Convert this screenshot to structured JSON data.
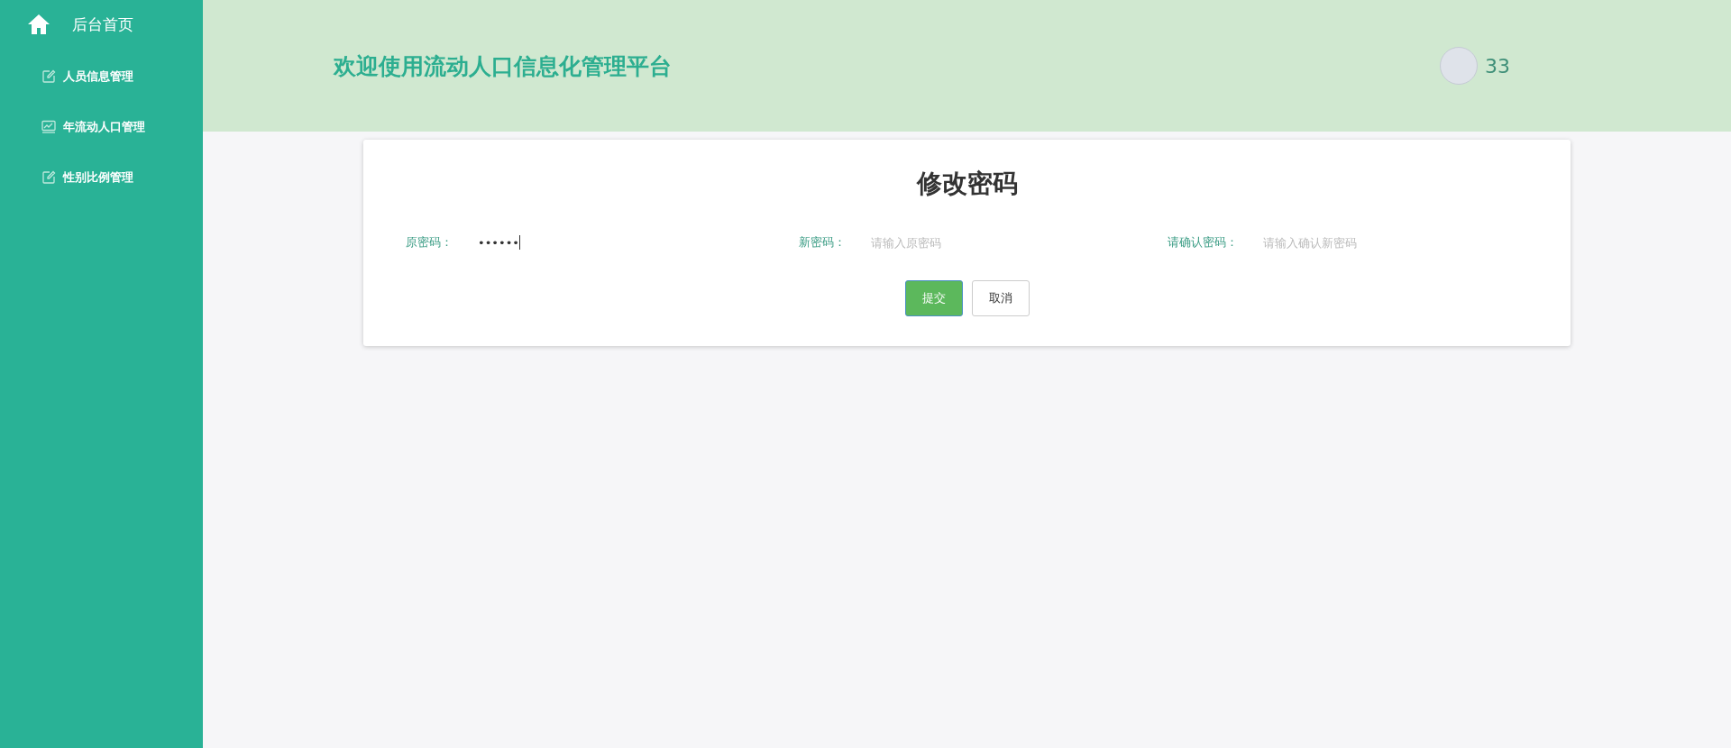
{
  "sidebar": {
    "home": {
      "label": "后台首页"
    },
    "items": [
      {
        "label": "人员信息管理",
        "kind": "edit"
      },
      {
        "label": "年流动人口管理",
        "kind": "chart"
      },
      {
        "label": "性别比例管理",
        "kind": "edit"
      }
    ]
  },
  "header": {
    "title": "欢迎使用流动人口信息化管理平台",
    "user": {
      "name": "33"
    }
  },
  "form": {
    "title": "修改密码",
    "fields": [
      {
        "label": "原密码：",
        "value": "••••••",
        "focused": true
      },
      {
        "label": "新密码：",
        "placeholder": "请输入原密码",
        "focused": false
      },
      {
        "label": "请确认密码：",
        "placeholder": "请输入确认新密码",
        "focused": false
      }
    ],
    "buttons": [
      {
        "label": "提交",
        "kind": "primary"
      },
      {
        "label": "取消",
        "kind": "default"
      }
    ]
  }
}
